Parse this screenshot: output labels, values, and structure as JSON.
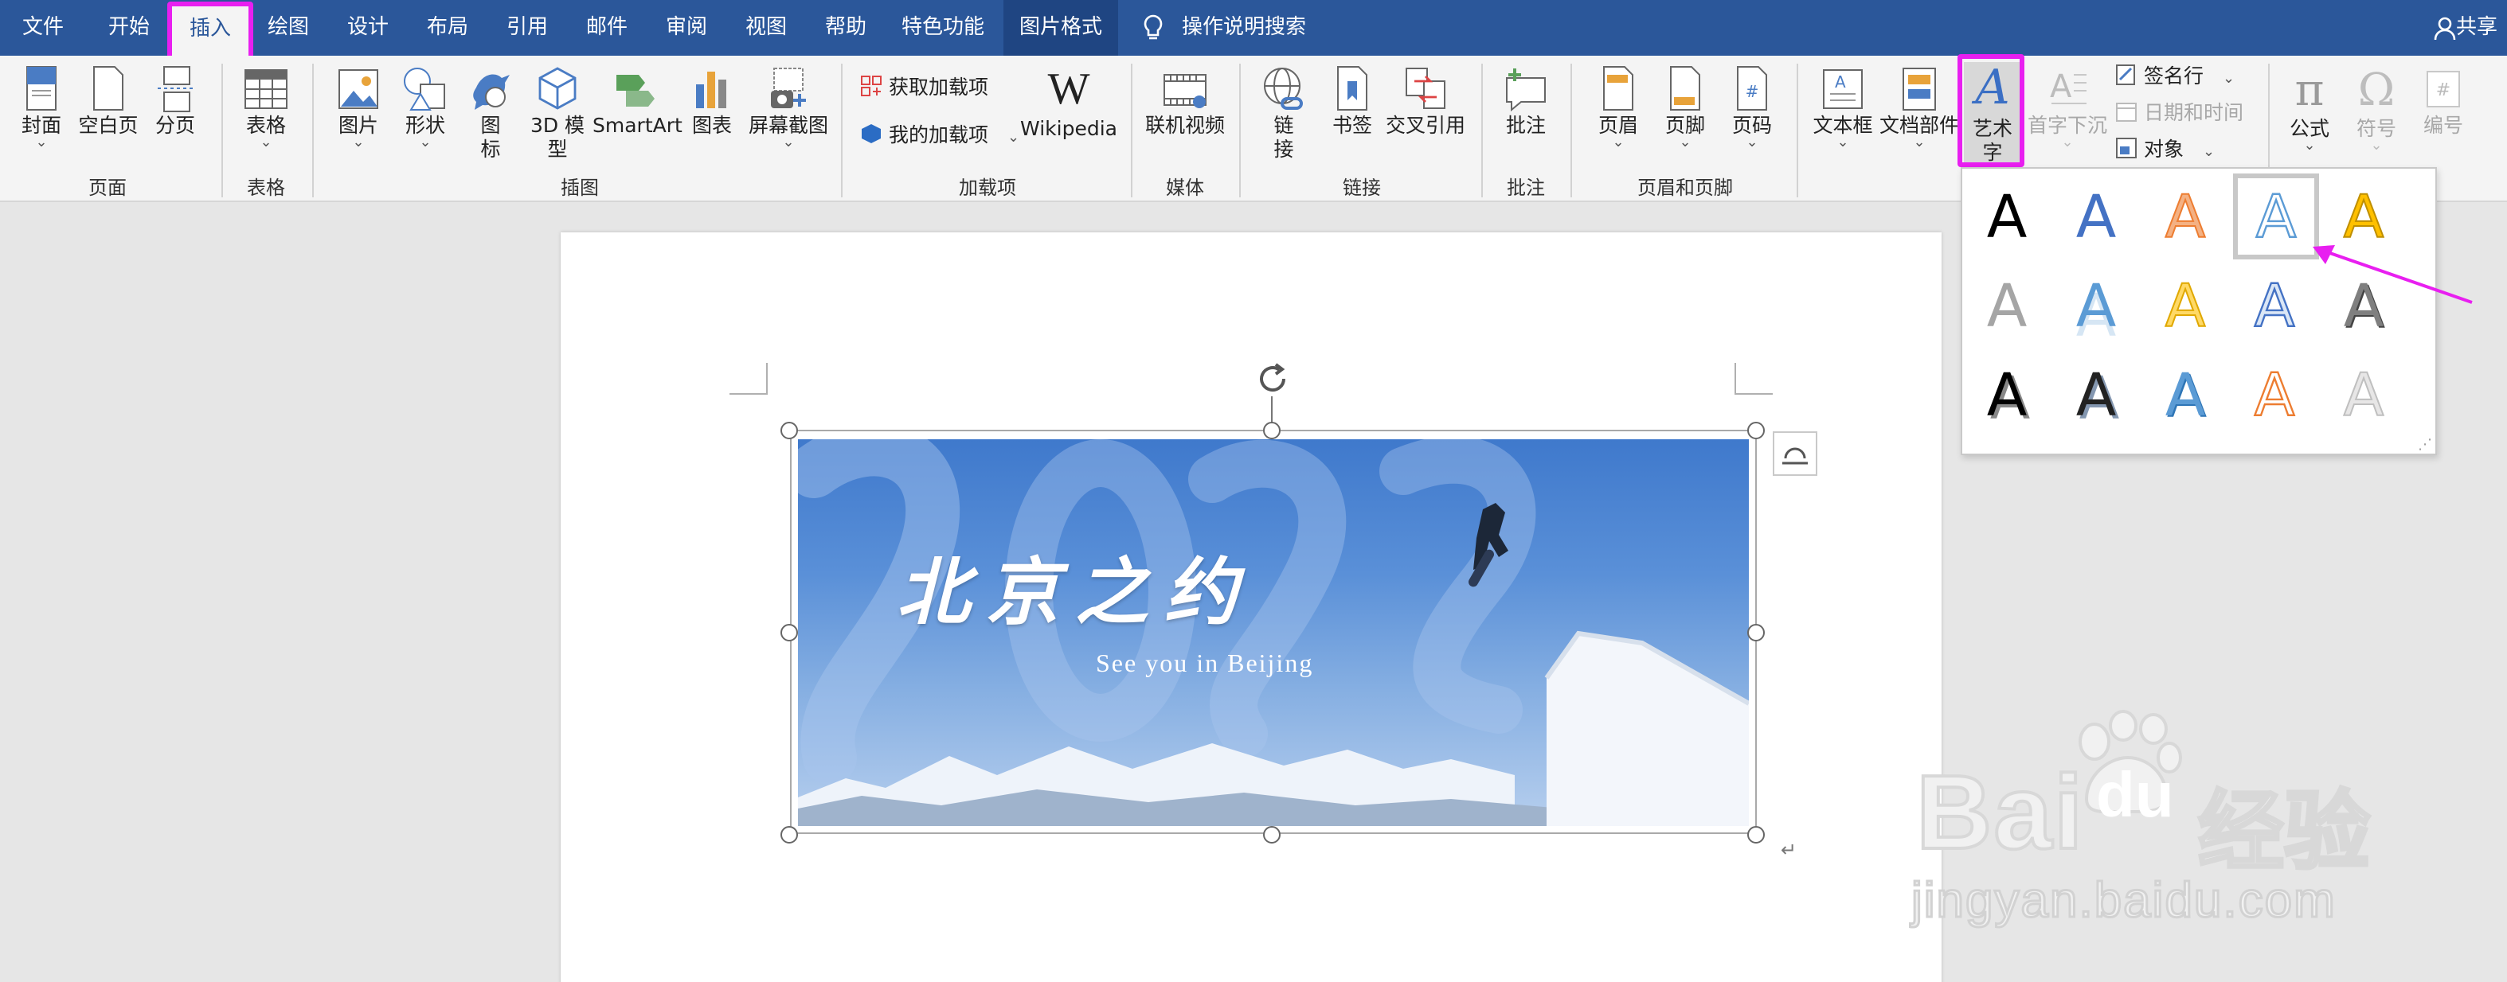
{
  "menubar": {
    "tabs": [
      "文件",
      "开始",
      "插入",
      "绘图",
      "设计",
      "布局",
      "引用",
      "邮件",
      "审阅",
      "视图",
      "帮助",
      "特色功能",
      "图片格式"
    ],
    "active_tab": "插入",
    "search_label": "操作说明搜索",
    "share_label": "共享"
  },
  "ribbon": {
    "groups": {
      "pages": "页面",
      "tables": "表格",
      "illustrations": "插图",
      "addins": "加载项",
      "media": "媒体",
      "links": "链接",
      "comments": "批注",
      "header_footer": "页眉和页脚"
    },
    "buttons": {
      "cover": "封面",
      "blank_page": "空白页",
      "page_break": "分页",
      "table": "表格",
      "picture": "图片",
      "shapes": "形状",
      "icons_1": "图",
      "icons_2": "标",
      "model3d_1": "3D 模",
      "model3d_2": "型",
      "smartart": "SmartArt",
      "chart": "图表",
      "screenshot": "屏幕截图",
      "get_addins": "获取加载项",
      "my_addins": "我的加载项",
      "wikipedia": "Wikipedia",
      "online_video": "联机视频",
      "link_1": "链",
      "link_2": "接",
      "bookmark": "书签",
      "cross_ref": "交叉引用",
      "comment": "批注",
      "header": "页眉",
      "footer": "页脚",
      "page_number": "页码",
      "textbox": "文本框",
      "quick_parts": "文档部件",
      "wordart": "艺术字",
      "dropcap": "首字下沉",
      "signature": "签名行",
      "datetime": "日期和时间",
      "object": "对象",
      "equation": "公式",
      "symbol": "符号",
      "number": "编号"
    }
  },
  "document": {
    "image_title": "北京之约",
    "image_subtitle": "See you in Beijing",
    "paragraph_mark": "↵"
  },
  "wordart_gallery": {
    "letter": "A",
    "selected_index": 3
  },
  "watermark": {
    "brand": "Bai",
    "brand2": "du",
    "cn": "经验",
    "url": "jingyan.baidu.com"
  },
  "colors": {
    "menubar": "#2b579a",
    "highlight": "#e81ff0",
    "ribbon": "#f4f4f4",
    "canvas": "#e6e6e6"
  }
}
